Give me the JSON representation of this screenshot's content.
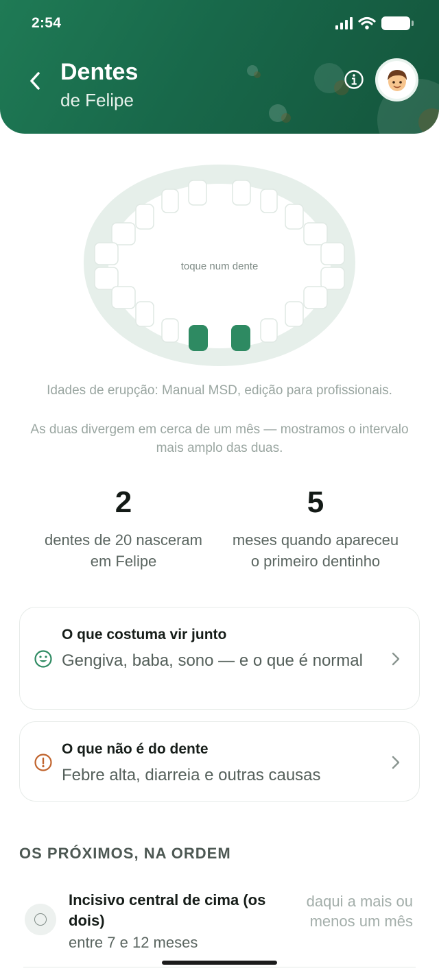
{
  "status_bar": {
    "time": "2:54"
  },
  "header": {
    "title": "Dentes",
    "subtitle": "de Felipe",
    "avatar_emoji": "👦",
    "colors": {
      "gradient_start": "#1f7a55",
      "gradient_end": "#14553c"
    }
  },
  "mouth": {
    "hint": "toque num dente",
    "teeth_total": 20,
    "erupted_teeth": [
      "lower-central-incisor-left",
      "lower-central-incisor-right"
    ],
    "colors": {
      "arch": "#e6efea",
      "tooth_empty": "#ffffff",
      "tooth_erupted": "#2e8a62"
    }
  },
  "source_note": {
    "line1": "Idades de erupção: Manual MSD, edição para profissionais.",
    "line2": "As duas divergem em cerca de um mês — mostramos o intervalo mais amplo das duas."
  },
  "stats": [
    {
      "value": "2",
      "label": "dentes de 20 nasceram em Felipe"
    },
    {
      "value": "5",
      "label": "meses quando apareceu o primeiro dentinho"
    }
  ],
  "cards": [
    {
      "icon": "smile-icon",
      "title": "O que costuma vir junto",
      "description": "Gengiva, baba, sono — e o que é normal",
      "accent": "#2e8a62"
    },
    {
      "icon": "alert-icon",
      "title": "O que não é do dente",
      "description": "Febre alta, diarreia e outras causas",
      "accent": "#c0632c"
    }
  ],
  "next_section": {
    "title": "OS PRÓXIMOS, NA ORDEM",
    "items": [
      {
        "name": "Incisivo central de cima (os dois)",
        "range": "entre 7 e 12 meses",
        "eta": "daqui a mais ou menos um mês"
      }
    ]
  }
}
